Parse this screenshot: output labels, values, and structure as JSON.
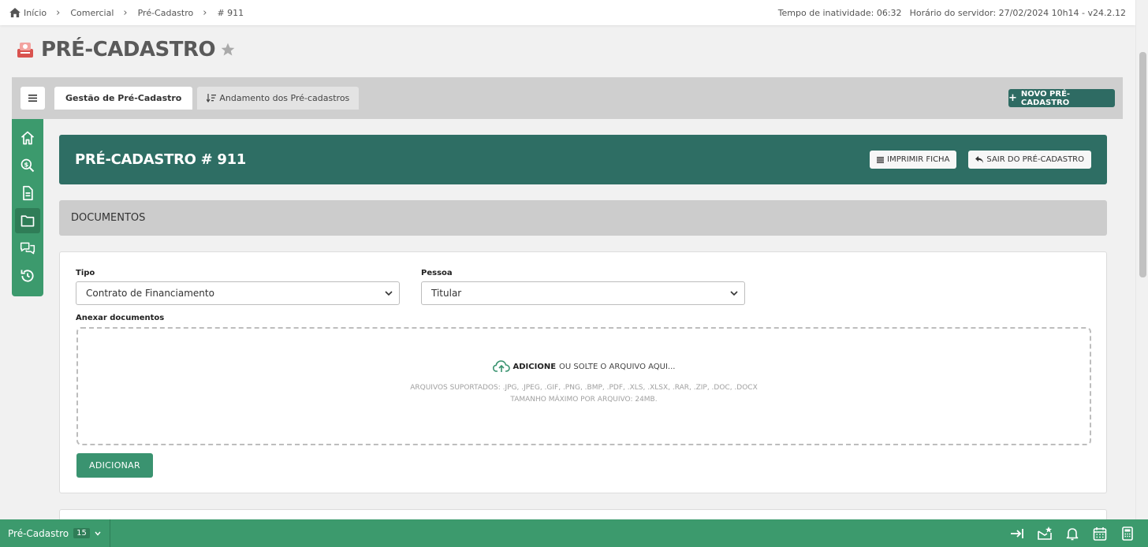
{
  "breadcrumb": {
    "items": [
      "Início",
      "Comercial",
      "Pré-Cadastro",
      "# 911"
    ]
  },
  "topbar": {
    "inactivity": "Tempo de inatividade: 06:32",
    "server_time": "Horário do servidor: 27/02/2024 10h14 - v24.2.12"
  },
  "page": {
    "title": "PRÉ-CADASTRO"
  },
  "tabs": [
    {
      "label": "Gestão de Pré-Cadastro",
      "active": true
    },
    {
      "label": "Andamento dos Pré-cadastros",
      "active": false
    }
  ],
  "new_button": "NOVO PRÉ-CADASTRO",
  "sidenav": {
    "items": [
      "home-icon",
      "search-dollar-icon",
      "document-icon",
      "folder-icon",
      "chat-icon",
      "history-icon"
    ],
    "active_index": 3
  },
  "header": {
    "title": "PRÉ-CADASTRO # 911",
    "print_label": "IMPRIMIR FICHA",
    "exit_label": "SAIR DO PRÉ-CADASTRO"
  },
  "section": {
    "title": "DOCUMENTOS"
  },
  "form": {
    "tipo_label": "Tipo",
    "tipo_value": "Contrato de Financiamento",
    "pessoa_label": "Pessoa",
    "pessoa_value": "Titular",
    "anexar_label": "Anexar documentos",
    "dropzone_bold": "ADICIONE",
    "dropzone_text": "OU SOLTE O ARQUIVO AQUI...",
    "supported": "ARQUIVOS SUPORTADOS: .JPG, .JPEG, .GIF, .PNG, .BMP, .PDF, .XLS, .XLSX, .RAR, .ZIP, .DOC, .DOCX",
    "max_size": "TAMANHO MÁXIMO POR ARQUIVO: 24MB.",
    "add_button": "ADICIONAR"
  },
  "bottombar": {
    "module": "Pré-Cadastro",
    "count": "15"
  },
  "colors": {
    "primary_dark": "#2e6e64",
    "primary_green": "#3c9a6d"
  }
}
